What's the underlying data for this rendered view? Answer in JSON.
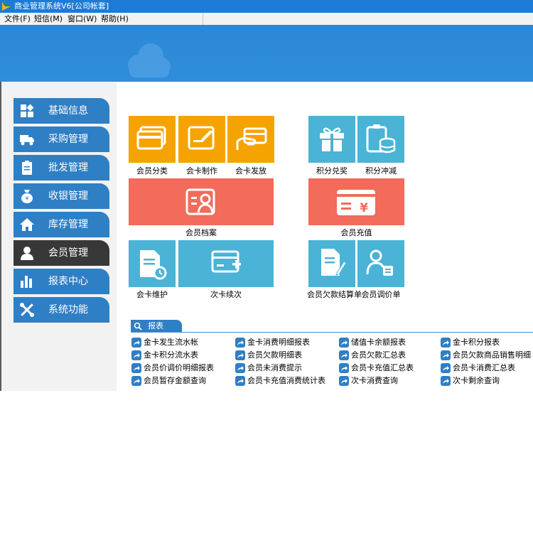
{
  "app": {
    "title": "商业管理系统V6[公司帐套]"
  },
  "menu": [
    "文件(F)",
    "短信(M)",
    "窗口(W)",
    "帮助(H)"
  ],
  "sidebar": {
    "items": [
      {
        "label": "基础信息",
        "icon": "grid-icon"
      },
      {
        "label": "采购管理",
        "icon": "truck-icon"
      },
      {
        "label": "批发管理",
        "icon": "clipboard-icon"
      },
      {
        "label": "收银管理",
        "icon": "money-bag-icon"
      },
      {
        "label": "库存管理",
        "icon": "home-icon"
      },
      {
        "label": "会员管理",
        "icon": "person-icon",
        "active": true
      },
      {
        "label": "报表中心",
        "icon": "bar-chart-icon"
      },
      {
        "label": "系统功能",
        "icon": "tools-icon"
      }
    ]
  },
  "tiles": {
    "member_category": "会员分类",
    "card_make": "会卡制作",
    "card_issue": "会卡发放",
    "points_redeem": "积分兑奖",
    "points_offset": "积分冲减",
    "member_file": "会员档案",
    "member_recharge": "会员充值",
    "card_maintain": "会卡维护",
    "card_renew": "次卡续次",
    "arrears_settle": "会员欠款结算单",
    "price_adjust": "会员调价单"
  },
  "reports": {
    "title": "报表",
    "items": [
      "金卡发生流水帐",
      "金卡消费明细报表",
      "储值卡余额报表",
      "金卡积分报表",
      "金卡积分流水表",
      "会员欠款明细表",
      "会员欠款汇总表",
      "会员欠款商品销售明细",
      "会员价调价明细报表",
      "会员未消费提示",
      "会员卡充值汇总表",
      "会员卡消费汇总表",
      "会员暂存金额查询",
      "会员卡充值消费统计表",
      "次卡消费查询",
      "次卡剩余查询"
    ]
  },
  "colors": {
    "titlebar": "#1b7bd6",
    "banner": "#2f8edc",
    "nav": "#2f7fc5",
    "nav_active": "#383838",
    "tile_orange": "#f5a300",
    "tile_red": "#f26b5b",
    "tile_blue": "#4ab3d6"
  }
}
